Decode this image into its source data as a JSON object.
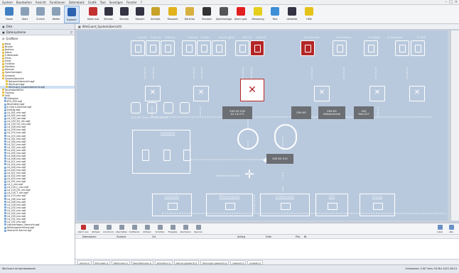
{
  "menu": [
    "System",
    "Bearbeiten",
    "Ansicht",
    "Funktionen",
    "Datenbank",
    "Grafik",
    "Tool",
    "Sonstiges",
    "Fenster",
    "?"
  ],
  "ribbon": [
    {
      "label": "Home",
      "color": "#3f7fc2"
    },
    {
      "label": "Start",
      "color": "#8aa0b8"
    },
    {
      "label": "Zurück",
      "color": "#8aa0b8"
    },
    {
      "label": "Weiter",
      "color": "#8aa0b8"
    },
    {
      "label": "Explorer",
      "color": "#2c63b0"
    },
    {
      "label": "Alarm aus",
      "color": "#c23030"
    },
    {
      "label": "Simulat.",
      "color": "#334"
    },
    {
      "label": "Simulat.",
      "color": "#334"
    },
    {
      "label": "Steuern",
      "color": "#334"
    },
    {
      "label": "Anmeld.",
      "color": "#c9a22a"
    },
    {
      "label": "Passwort",
      "color": "#e0b21c"
    },
    {
      "label": "Berichte",
      "color": "#d7b040"
    },
    {
      "label": "Drucken",
      "color": "#333"
    },
    {
      "label": "Sprechanlage",
      "color": "#555"
    },
    {
      "label": "Alarm quit.",
      "color": "#e21f1f"
    },
    {
      "label": "Steuerung",
      "color": "#e6cf1c"
    },
    {
      "label": "Tore",
      "color": "#3d8fd6"
    },
    {
      "label": "Leitstelle",
      "color": "#334"
    },
    {
      "label": "Hilfe",
      "color": "#e5c21a"
    }
  ],
  "left": {
    "ortsliste": "Orte",
    "dateisystem": "Dateisysteme",
    "tree_header": "Grafiken"
  },
  "tree": [
    "Basis",
    "Brücke",
    "Buttons",
    "Demo",
    "E-Werkstatt",
    "Emas",
    "Emet",
    "Funktion",
    "Monitors",
    "Rahmen",
    "Sprechanlagen",
    "Symbole",
    "Systemübersicht",
    "Netzwerkübersicht.wgf",
    "WinGuard.wgf",
    "WinGuard_Systemübersicht.wgf",
    "Touchoberfläche",
    "Training",
    "UNG",
    "Videoplan",
    "BT4_EG5.wgf",
    "Beschalten.wgf",
    "E-Geb.4-Zentrale.wgf",
    "Eintrag.wgf",
    "LA_001_neu.wgf",
    "LA_002_neu.wgf",
    "LA_C02_neu.wgf",
    "LA_C03_EG_neu.wgf",
    "LA_C05_OG_neu.wgf",
    "LA_206_neu.wgf",
    "LA_209_neu.wgf",
    "LA_214_neu.wgf",
    "LA_215_neu.wgf",
    "LA_301_neu.wgf",
    "LA_304_neu.wgf",
    "LA_312_neu.wgf",
    "LA_322_neu.wgf",
    "LA_402_neu.wgf",
    "LA_405_neu.wgf",
    "LA_406_neu.wgf",
    "LA_408_neu.wgf",
    "LA_411_neu.wgf",
    "LA_414_neu.wgf",
    "LA_418_neu.wgf",
    "LA_420_neu.wgf",
    "LA_421_neu.wgf",
    "LA_422_neu.wgf",
    "LA_423_neu.wgf",
    "LA_431_neu.wgf",
    "LA_1_neu.wgf",
    "LA_116_C_neu.wgf",
    "LA_116_OG_neu.wgf",
    "LA_116_T_neu.wgf",
    "LA_119_neu.wgf",
    "LA_206_neu.wgf",
    "LA_206_neu.wgf",
    "LA_218_neu.wgf",
    "LA_220_neu.wgf",
    "LA_222_neu.wgf",
    "LA_224_neu.wgf",
    "LA_230_neu.wgf",
    "LA_231_neu.wgf",
    "LA_232_neu.wgf",
    "Löschanlagen_Übersicht.wgf",
    "Meldungsverteilung.wgf",
    "Übersicht Alarme.wgf"
  ],
  "doc_tab": "WinGuard_Systemübersicht",
  "diagram": {
    "top_labels": [
      "1.Brand",
      "2.Brand",
      "3.Brand",
      "4.Brand",
      "5.Einbr.",
      "6.Aufzug",
      "Z02",
      "Z09-1G",
      "Z09-2G",
      "8.Sicherheit",
      "Videoüberw.",
      "10.Objekt",
      "11.Netzwerk",
      "12.EDV"
    ],
    "gray_boxes": [
      "Z09-EG S18\n10.1.6.171",
      "Z09-KG",
      "Z09-KG\nVideoschrank",
      "V42\nFeld 017",
      "Z09-EG S19"
    ],
    "server_caption": "ZOS-MS Cheb  OPC/DB Server",
    "leitstelle_top": "Leitstelle",
    "network_caption": "Netzwerk/Protokoll",
    "bottom_boxes": [
      "Leitstelle",
      "Pförtnerplatz",
      "E-Werkstatt",
      "A55",
      "Emsig"
    ]
  },
  "bottom": {
    "tools": [
      "Alarm aus",
      "Ablösen",
      "Anrufnum.",
      "Abschalten",
      "Quittieren",
      "Ablösen",
      "Schalten",
      "Freigabe",
      "Alarmplan",
      "Sperren"
    ],
    "right_tools": [
      "Lokal",
      "Alle"
    ],
    "columns": [
      "Datensatznr.",
      "Zustand",
      "Ort",
      "Anfang",
      "Ende",
      "Prio.",
      "BL"
    ],
    "status": [
      "Alarme 0",
      "Störungen 0",
      "Meldungen 0",
      "Beschaltungen 0",
      "Simulation 0",
      "Alarme (gesperrt) 0",
      "Störungen (gesperrt) 0",
      "Gesperrt 0",
      "Auswahl 0"
    ]
  },
  "statusbar": {
    "left": "WinGuard ist betriebsbereit.",
    "right": "Ortsalarme: 0   W7 Vers: 03 Mrz 2021 08:13"
  }
}
